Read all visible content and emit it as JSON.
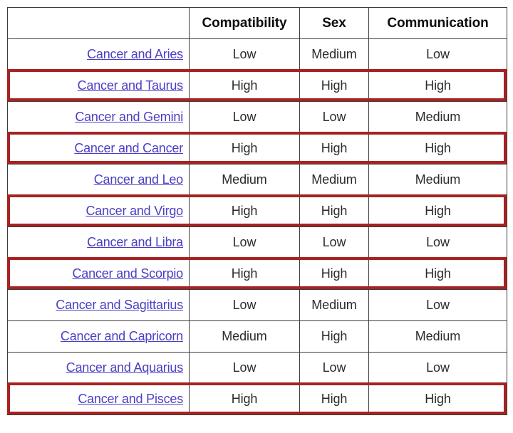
{
  "page": {
    "background_color": "#ffffff",
    "link_color": "#4b40c4",
    "highlight_border_color": "#a72222",
    "grid_border_color": "#3c3c3c",
    "value_text_color": "#2b2b2b",
    "header_text_color": "#0c0c0c"
  },
  "table": {
    "name": "cancer-compatibility-table",
    "headers": {
      "pair": "",
      "compatibility": "Compatibility",
      "sex": "Sex",
      "communication": "Communication"
    },
    "rows": [
      {
        "pair": "Cancer and Aries",
        "compatibility": "Low",
        "sex": "Medium",
        "communication": "Low",
        "highlighted": false
      },
      {
        "pair": "Cancer and Taurus",
        "compatibility": "High",
        "sex": "High",
        "communication": "High",
        "highlighted": true
      },
      {
        "pair": "Cancer and Gemini",
        "compatibility": "Low",
        "sex": "Low",
        "communication": "Medium",
        "highlighted": false
      },
      {
        "pair": "Cancer and Cancer",
        "compatibility": "High",
        "sex": "High",
        "communication": "High",
        "highlighted": true
      },
      {
        "pair": "Cancer and Leo",
        "compatibility": "Medium",
        "sex": "Medium",
        "communication": "Medium",
        "highlighted": false
      },
      {
        "pair": "Cancer and Virgo",
        "compatibility": "High",
        "sex": "High",
        "communication": "High",
        "highlighted": true
      },
      {
        "pair": "Cancer and Libra",
        "compatibility": "Low",
        "sex": "Low",
        "communication": "Low",
        "highlighted": false
      },
      {
        "pair": "Cancer and Scorpio",
        "compatibility": "High",
        "sex": "High",
        "communication": "High",
        "highlighted": true
      },
      {
        "pair": "Cancer and Sagittarius",
        "compatibility": "Low",
        "sex": "Medium",
        "communication": "Low",
        "highlighted": false
      },
      {
        "pair": "Cancer and Capricorn",
        "compatibility": "Medium",
        "sex": "High",
        "communication": "Medium",
        "highlighted": false
      },
      {
        "pair": "Cancer and Aquarius",
        "compatibility": "Low",
        "sex": "Low",
        "communication": "Low",
        "highlighted": false
      },
      {
        "pair": "Cancer and Pisces",
        "compatibility": "High",
        "sex": "High",
        "communication": "High",
        "highlighted": true
      }
    ]
  }
}
